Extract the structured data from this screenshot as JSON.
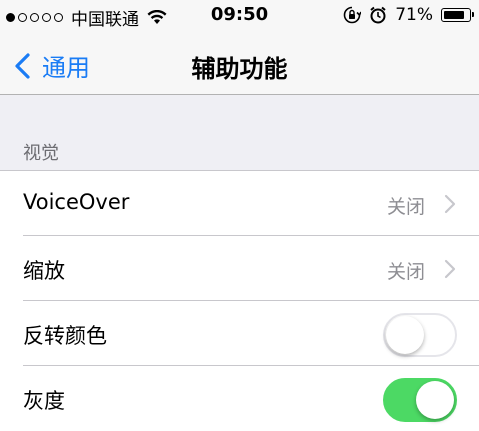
{
  "status_bar": {
    "signal_dots": [
      true,
      false,
      false,
      false,
      false
    ],
    "carrier": "中国联通",
    "time": "09:50",
    "battery": "71%",
    "battery_level": 0.71
  },
  "nav": {
    "back_label": "通用",
    "title": "辅助功能"
  },
  "section": {
    "header": "视觉",
    "rows": [
      {
        "label": "VoiceOver",
        "value": "关闭",
        "type": "disclosure"
      },
      {
        "label": "缩放",
        "value": "关闭",
        "type": "disclosure"
      },
      {
        "label": "反转颜色",
        "type": "toggle",
        "state": "off"
      },
      {
        "label": "灰度",
        "type": "toggle",
        "state": "on"
      }
    ]
  },
  "colors": {
    "accent": "#1a7cf5",
    "toggle_on": "#4cd964",
    "secondary_text": "#8e8e93"
  }
}
